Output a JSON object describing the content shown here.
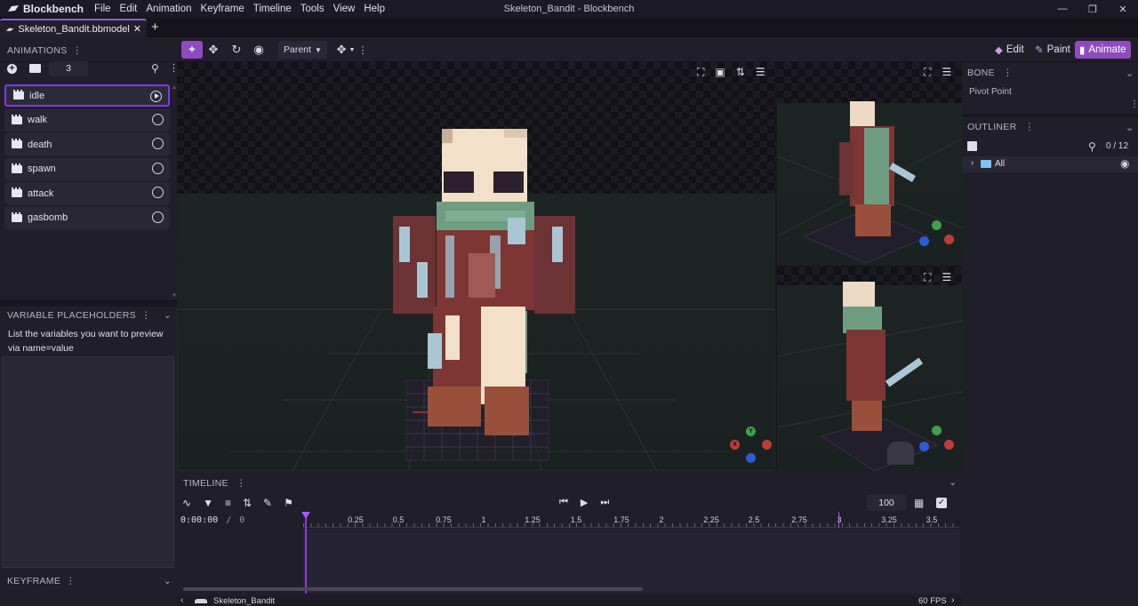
{
  "app": {
    "name": "Blockbench",
    "window_title": "Skeleton_Bandit - Blockbench"
  },
  "menu": [
    "File",
    "Edit",
    "Animation",
    "Keyframe",
    "Timeline",
    "Tools",
    "View",
    "Help"
  ],
  "tab": {
    "label": "Skeleton_Bandit.bbmodel"
  },
  "toolbar": {
    "space_select": "Parent"
  },
  "modes": {
    "edit": "Edit",
    "paint": "Paint",
    "animate": "Animate"
  },
  "animations_panel": {
    "title": "ANIMATIONS",
    "count": "3",
    "items": [
      {
        "label": "idle",
        "selected": true
      },
      {
        "label": "walk"
      },
      {
        "label": "death"
      },
      {
        "label": "spawn"
      },
      {
        "label": "attack"
      },
      {
        "label": "gasbomb"
      }
    ]
  },
  "variable_placeholders": {
    "title": "VARIABLE PLACEHOLDERS",
    "hint": "List the variables you want to preview via name=value"
  },
  "keyframe_panel": {
    "title": "KEYFRAME"
  },
  "bone_panel": {
    "title": "BONE",
    "pivot_label": "Pivot Point"
  },
  "outliner": {
    "title": "OUTLINER",
    "count": "0 / 12",
    "root": "All"
  },
  "timeline": {
    "title": "TIMELINE",
    "time": "0:00:00",
    "separator": "/",
    "length": "0",
    "zoom": "100",
    "ticks": [
      "0.25",
      "0.5",
      "0.75",
      "1",
      "1.25",
      "1.5",
      "1.75",
      "2",
      "2.25",
      "2.5",
      "2.75",
      "3",
      "3.25",
      "3.5"
    ],
    "footer_name": "Skeleton_Bandit",
    "fps": "60 FPS"
  },
  "gizmo": {
    "x": "X",
    "y": "Y",
    "z": "Z"
  },
  "colors": {
    "accent": "#8e4bbf",
    "panel": "#201e29",
    "background": "#17161f"
  }
}
